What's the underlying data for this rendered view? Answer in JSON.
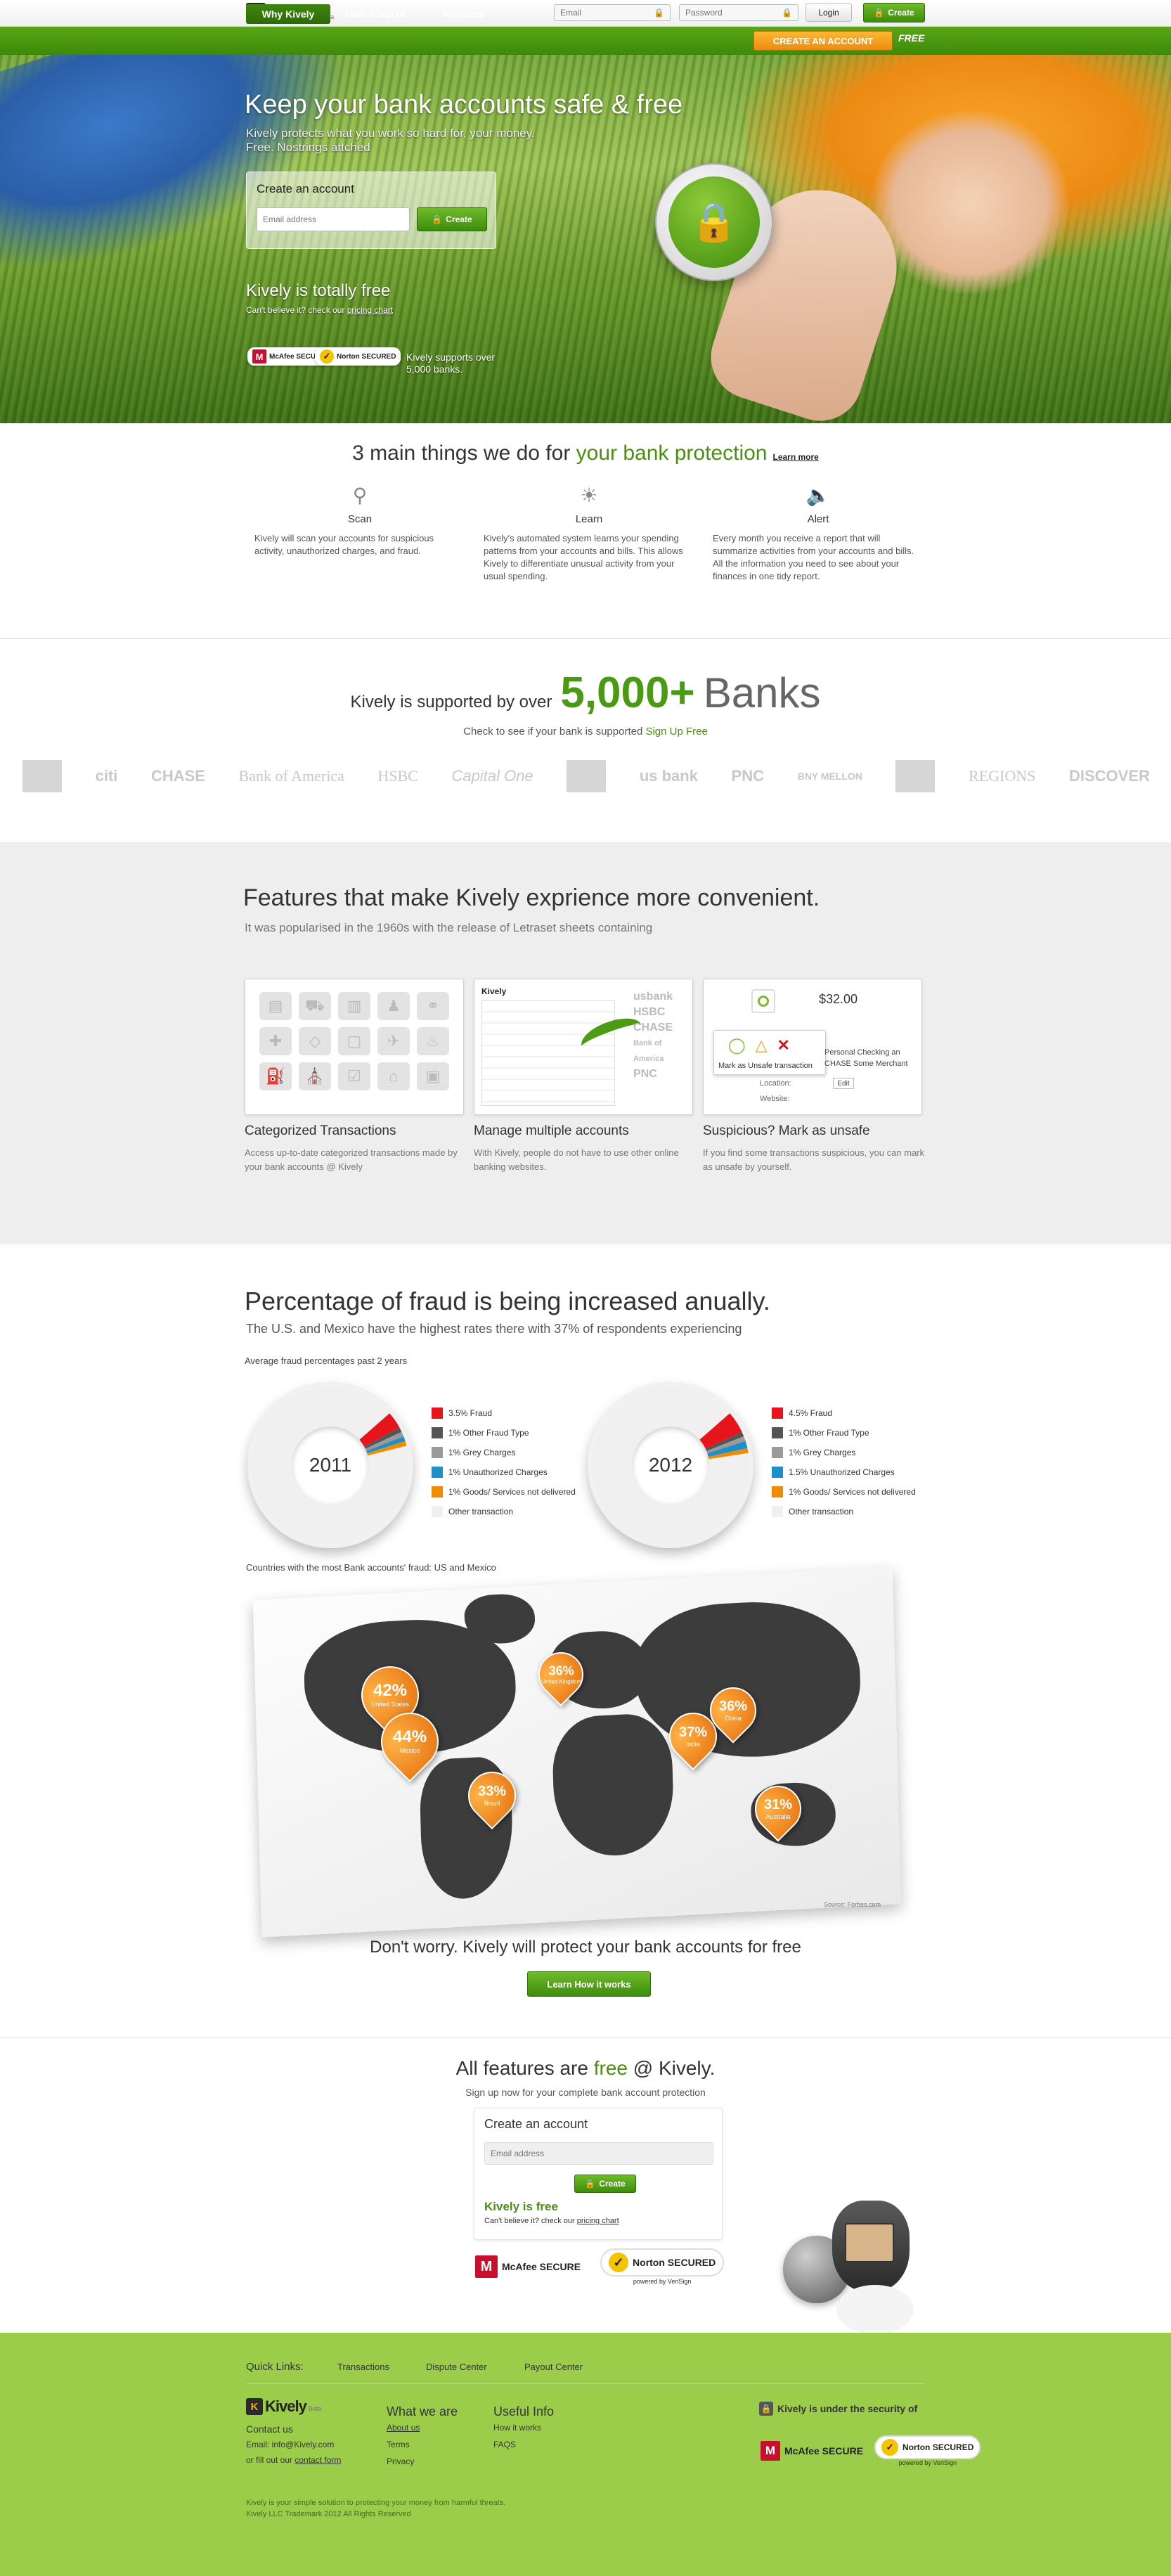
{
  "header": {
    "logo_text": "Kively",
    "logo_beta": "Beta",
    "email_placeholder": "Email",
    "password_placeholder": "Password",
    "login_label": "Login",
    "create_label": "Create"
  },
  "nav": {
    "items": [
      "Why Kively",
      "How it works",
      "Features"
    ],
    "cta_label": "CREATE AN ACCOUNT",
    "free_tag": "FREE"
  },
  "hero": {
    "title": "Keep your bank accounts safe & free",
    "subtitle_1": "Kively protects what you work so hard for, your money.",
    "subtitle_2": "Free. Nostrings attched",
    "form_title": "Create an account",
    "email_placeholder": "Email address",
    "create_label": "Create",
    "free_title": "Kively is totally free",
    "free_sub_pre": "Can't believe it? check our ",
    "free_sub_link": "pricing chart",
    "mcafee": "McAfee SECURE",
    "norton": "Norton SECURED",
    "banks_support_1": "Kively supports over",
    "banks_support_2": "5,000 banks."
  },
  "things": {
    "title_a": "3 main things we do for ",
    "title_b": "your bank protection",
    "learn_more": "Learn more",
    "items": [
      {
        "icon": "search-icon",
        "name": "Scan",
        "desc": "Kively will scan your accounts for suspicious activity, unauthorized charges, and fraud."
      },
      {
        "icon": "lightbulb-icon",
        "name": "Learn",
        "desc": "Kively's automated system learns your spending patterns from your accounts and bills. This allows Kively to differentiate unusual activity from your usual spending."
      },
      {
        "icon": "speaker-icon",
        "name": "Alert",
        "desc": "Every month you receive a report that will summarize activities from your accounts and bills. All the information you need to see about your finances in one tidy report."
      }
    ]
  },
  "banks": {
    "supported_a": "Kively is supported by over",
    "supported_num": "5,000+",
    "supported_b": "Banks",
    "check_pre": "Check to see if your bank is supported ",
    "check_link": "Sign Up Free",
    "logos": [
      "citi",
      "CHASE",
      "Bank of America",
      "HSBC",
      "Capital One",
      "us bank",
      "PNC",
      "BNY MELLON",
      "REGIONS",
      "DISCOVER"
    ]
  },
  "features": {
    "title": "Features that make Kively exprience more convenient.",
    "subtitle": "It was popularised in the 1960s with the release of Letraset sheets containing",
    "cards": [
      {
        "name": "Categorized Transactions",
        "desc": "Access up-to-date categorized transactions made by your bank accounts @ Kively"
      },
      {
        "name": "Manage multiple accounts",
        "desc": "With Kively, people do not have to use other online banking websites."
      },
      {
        "name": "Suspicious? Mark as unsafe",
        "desc": "If you find some transactions suspicious, you can mark as unsafe by yourself."
      }
    ],
    "card3_amount": "$32.00",
    "card3_tooltip": "Mark as Unsafe transaction",
    "card3_detail_1": "Personal Checking an",
    "card3_detail_2": "CHASE Some Merchant",
    "card3_location": "Location:",
    "card3_edit": "Edit",
    "card3_website": "Website:",
    "card2_logo": "Kively",
    "card2_bank_1": "usbank",
    "card2_bank_2": "HSBC",
    "card2_bank_3": "CHASE",
    "card2_bank_4": "Bank of America",
    "card2_bank_5": "PNC"
  },
  "fraud": {
    "title": "Percentage of fraud is being increased anually.",
    "subtitle": "The U.S. and Mexico have the highest rates there with 37% of respondents experiencing",
    "chart_caption": "Average fraud percentages past 2 years",
    "map_caption": "Countries with the most Bank accounts' fraud: US and Mexico",
    "map_source": "Source: Forbes.com",
    "dont_worry": "Don't worry. Kively will protect your bank accounts for free",
    "learn_btn": "Learn How it works"
  },
  "chart_data": [
    {
      "type": "pie",
      "title": "2011",
      "labels": [
        "3.5% Fraud",
        "1% Other Fraud Type",
        "1% Grey Charges",
        "1% Unauthorized Charges",
        "1% Goods/ Services not delivered",
        "Other transaction"
      ],
      "values": [
        3.5,
        1,
        1,
        1,
        1,
        92.5
      ],
      "colors": [
        "#e8141b",
        "#555555",
        "#9a9a9a",
        "#1f8fc9",
        "#f08c00",
        "#f0f0f0"
      ]
    },
    {
      "type": "pie",
      "title": "2012",
      "labels": [
        "4.5% Fraud",
        "1% Other Fraud Type",
        "1% Grey Charges",
        "1.5% Unauthorized Charges",
        "1% Goods/ Services not delivered",
        "Other transaction"
      ],
      "values": [
        4.5,
        1,
        1,
        1.5,
        1,
        91
      ],
      "colors": [
        "#e8141b",
        "#555555",
        "#9a9a9a",
        "#1f8fc9",
        "#f08c00",
        "#f0f0f0"
      ]
    },
    {
      "type": "bar",
      "title": "",
      "categories": [
        "United States",
        "Mexico",
        "Brazil",
        "United Kingdom",
        "India",
        "China",
        "Australia"
      ],
      "values": [
        42,
        44,
        33,
        36,
        37,
        36,
        31
      ],
      "labels": [
        "42%",
        "44%",
        "33%",
        "36%",
        "37%",
        "36%",
        "31%"
      ]
    }
  ],
  "signup": {
    "title_a": "All features are ",
    "title_b": "free",
    "title_c": " @ Kively.",
    "subtitle": "Sign up now for your complete bank account protection",
    "form_title": "Create an account",
    "email_placeholder": "Email address",
    "create_label": "Create",
    "free_title": "Kively is free",
    "free_sub_pre": "Can't believe it? check our ",
    "free_sub_link": "pricing chart",
    "mcafee": "McAfee SECURE",
    "norton": "Norton SECURED",
    "verisign": "powered by VeriSign"
  },
  "footer": {
    "quick_links_label": "Quick Links:",
    "quick_links": [
      "Transactions",
      "Dispute Center",
      "Payout Center"
    ],
    "contact_title": "Contact us",
    "contact_email": "Email: info@Kively.com",
    "contact_form_pre": "or fill out our ",
    "contact_form_link": "contact form",
    "what_title": "What we are",
    "what_links": [
      "About us",
      "Terms",
      "Privacy"
    ],
    "useful_title": "Useful Info",
    "useful_links": [
      "How it works",
      "FAQS"
    ],
    "security_title": "Kively is under the security of",
    "tagline": "Kively is your simple solution to protecting your money from harmful threats.",
    "copyright": "Kively LLC Trademark 2012 All Rights Reserved"
  }
}
